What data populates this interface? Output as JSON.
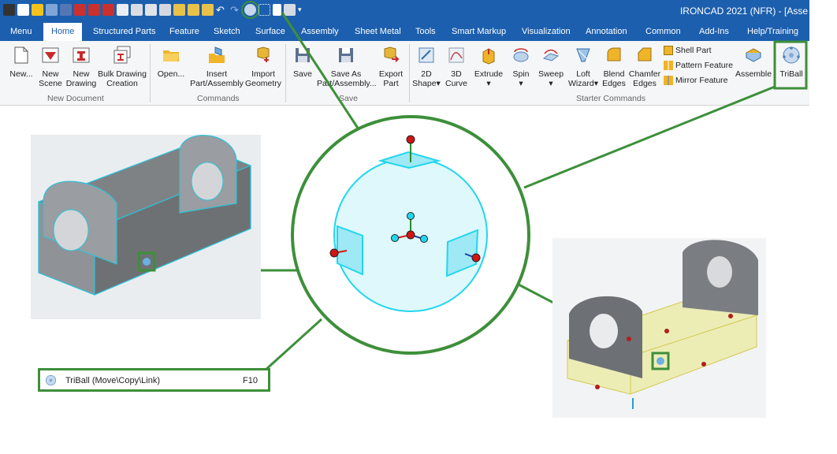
{
  "window_title": "IRONCAD 2021 (NFR) - [Asse",
  "tabs": [
    "Menu",
    "Home",
    "Structured Parts",
    "Feature",
    "Sketch",
    "Surface",
    "Assembly",
    "Sheet Metal",
    "Tools",
    "Smart Markup",
    "Visualization",
    "Annotation",
    "Common",
    "Add-Ins",
    "Help/Training"
  ],
  "active_tab": "Home",
  "groups": {
    "new_document": {
      "label": "New Document",
      "new": "New...",
      "new_scene": [
        "New",
        "Scene"
      ],
      "new_drawing": [
        "New",
        "Drawing"
      ],
      "bulk": [
        "Bulk Drawing",
        "Creation"
      ]
    },
    "commands": {
      "label": "Commands",
      "open": "Open...",
      "insert": [
        "Insert",
        "Part/Assembly"
      ],
      "import": [
        "Import",
        "Geometry"
      ]
    },
    "save": {
      "label": "Save",
      "save": "Save",
      "save_as": [
        "Save As",
        "Part/Assembly..."
      ],
      "export": [
        "Export",
        "Part"
      ]
    },
    "starter": {
      "label": "Starter Commands",
      "shape2d": [
        "2D",
        "Shape"
      ],
      "curve3d": [
        "3D",
        "Curve"
      ],
      "extrude": "Extrude",
      "spin": "Spin",
      "sweep": "Sweep",
      "loft": [
        "Loft",
        "Wizard"
      ],
      "blend": [
        "Blend",
        "Edges"
      ],
      "chamfer": [
        "Chamfer",
        "Edges"
      ],
      "shell": "Shell Part",
      "pattern": "Pattern Feature",
      "mirror": "Mirror Feature",
      "assemble": "Assemble",
      "triball": "TriBall"
    }
  },
  "menu_callout": {
    "label": "TriBall (Move\\Copy\\Link)",
    "shortcut": "F10"
  },
  "colors": {
    "titlebar": "#1c5fae",
    "highlight": "#3d8f3a",
    "triball": "#21d6ee"
  }
}
